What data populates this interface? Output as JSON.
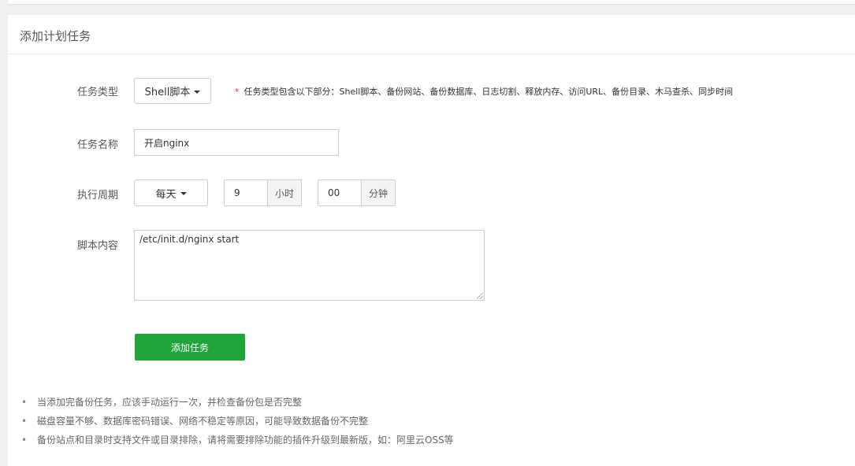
{
  "panel": {
    "title": "添加计划任务"
  },
  "form": {
    "task_type": {
      "label": "任务类型",
      "selected": "Shell脚本",
      "hint_star": "*",
      "hint": "任务类型包含以下部分：Shell脚本、备份网站、备份数据库、日志切割、释放内存、访问URL、备份目录、木马查杀、同步时间"
    },
    "task_name": {
      "label": "任务名称",
      "value": "开启nginx"
    },
    "cycle": {
      "label": "执行周期",
      "selected": "每天",
      "hour_value": "9",
      "hour_unit": "小时",
      "minute_value": "00",
      "minute_unit": "分钟"
    },
    "script": {
      "label": "脚本内容",
      "value": "/etc/init.d/nginx start"
    },
    "submit_label": "添加任务"
  },
  "notes": [
    "当添加完备份任务，应该手动运行一次，并检查备份包是否完整",
    "磁盘容量不够、数据库密码错误、网络不稳定等原因，可能导致数据备份不完整",
    "备份站点和目录时支持文件或目录排除，请将需要排除功能的插件升级到最新版，如：阿里云OSS等"
  ],
  "colors": {
    "primary": "#20a53a",
    "required_star": "#e4393c"
  }
}
